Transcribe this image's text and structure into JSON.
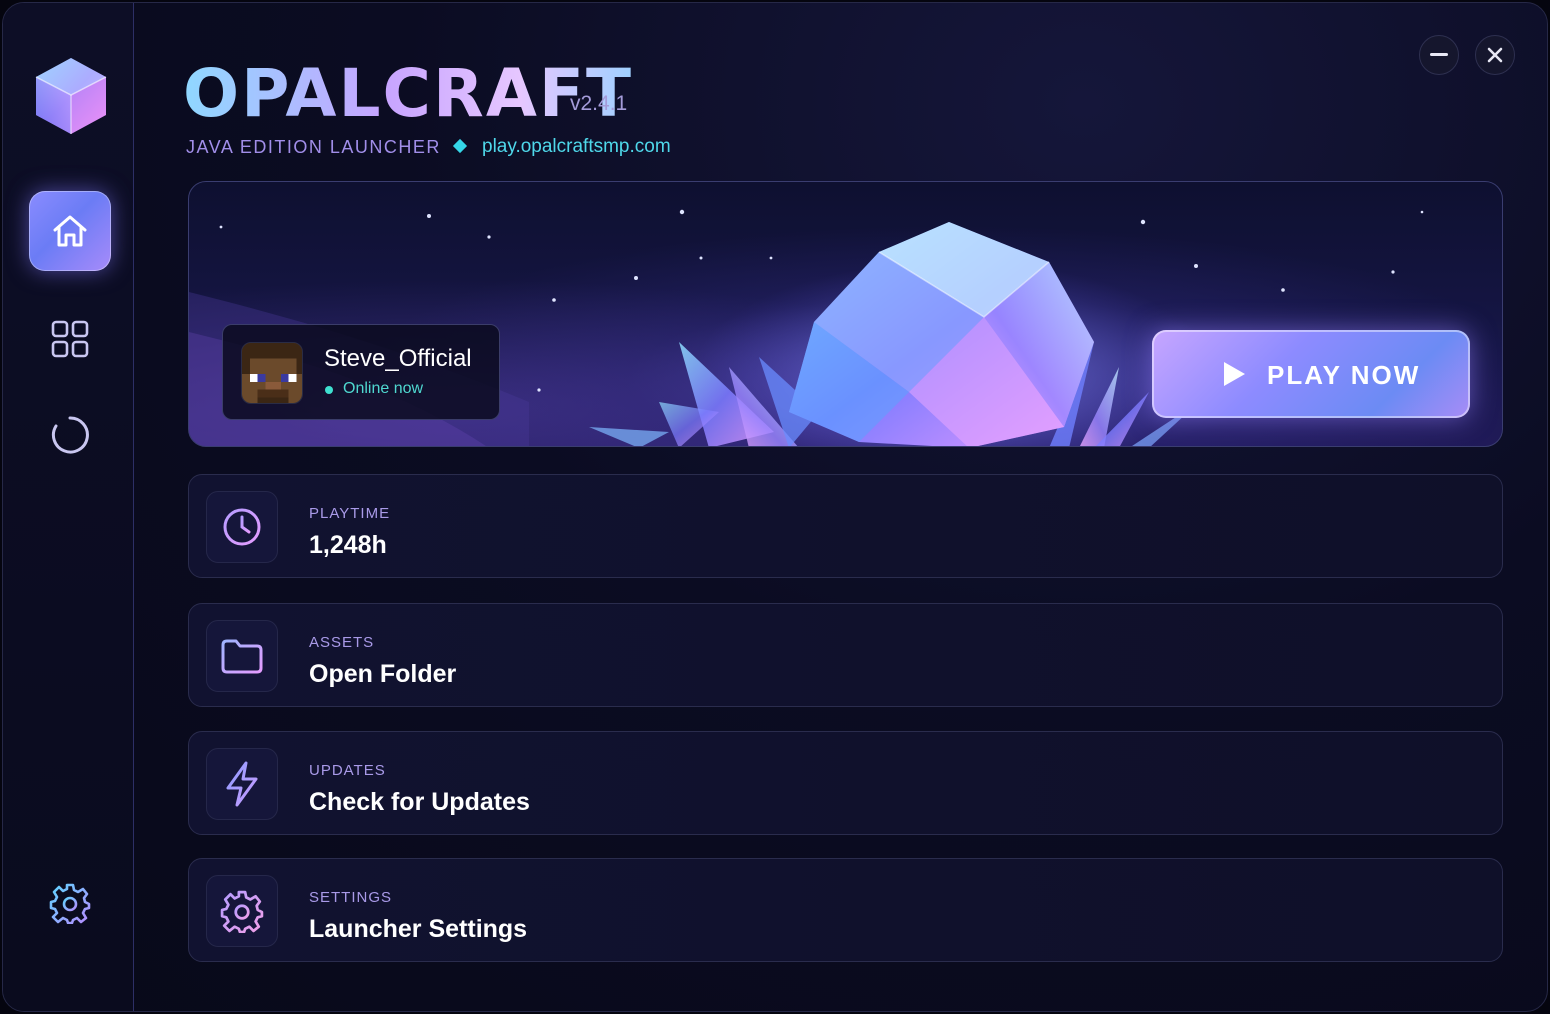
{
  "app": {
    "title": "OPALCRAFT",
    "version": "v2.4.1",
    "subtitle": "JAVA EDITION LAUNCHER",
    "server": "play.opalcraftsmp.com"
  },
  "window_controls": {
    "minimize_icon": "minus-icon",
    "close_icon": "close-icon"
  },
  "sidebar": {
    "items": [
      {
        "id": "home",
        "icon": "home-icon",
        "active": true
      },
      {
        "id": "grid",
        "icon": "grid-icon",
        "active": false
      },
      {
        "id": "refresh",
        "icon": "loading-circle-icon",
        "active": false
      },
      {
        "id": "settings",
        "icon": "gear-icon",
        "active": false
      }
    ]
  },
  "profile": {
    "name": "Steve_Official",
    "status": "Online now",
    "status_color": "#3fe0d0"
  },
  "play_button": {
    "label": "PLAY NOW",
    "icon": "play-icon"
  },
  "cards": [
    {
      "label": "PLAYTIME",
      "title": "1,248h",
      "icon": "clock-icon"
    },
    {
      "label": "ASSETS",
      "title": "Open Folder",
      "icon": "folder-icon"
    },
    {
      "label": "UPDATES",
      "title": "Check for Updates",
      "icon": "lightning-icon"
    },
    {
      "label": "SETTINGS",
      "title": "Launcher Settings",
      "icon": "gear-icon"
    }
  ],
  "colors": {
    "accent": "#8d8bff",
    "accent_cyan": "#4fd8ea",
    "label_purple": "#a99ae8",
    "background": "#0b0c22"
  }
}
